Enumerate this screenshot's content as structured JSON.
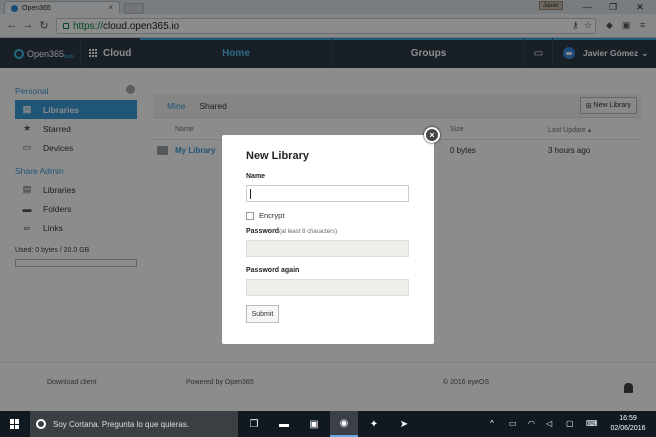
{
  "browser": {
    "tab_title": "Open365",
    "tab_close": "×",
    "profile_user": "Javier",
    "window_controls": [
      "—",
      "❐",
      "✕"
    ],
    "url_scheme": "https://",
    "url_host": "cloud.open365.io",
    "nav_icons": [
      "back-arrow-icon",
      "forward-arrow-icon",
      "reload-icon"
    ]
  },
  "app_header": {
    "logo": "Open365",
    "logo_badge": "beta",
    "cloud_label": "Cloud",
    "nav": [
      "Home",
      "Groups"
    ],
    "user_name": "Javier Gómez",
    "user_caret": "⌄",
    "accent_color": "#3aa7dd"
  },
  "sidebar": {
    "personal_title": "Personal",
    "personal_items": [
      {
        "label": "Libraries",
        "icon": "library-icon",
        "active": true
      },
      {
        "label": "Starred",
        "icon": "star-icon"
      },
      {
        "label": "Devices",
        "icon": "monitor-icon"
      }
    ],
    "share_title": "Share Admin",
    "share_items": [
      {
        "label": "Libraries",
        "icon": "library-icon"
      },
      {
        "label": "Folders",
        "icon": "folder-icon"
      },
      {
        "label": "Links",
        "icon": "link-icon"
      }
    ],
    "usage_text": "Used: 0 bytes / 20.0 GB",
    "usage_fraction": 0
  },
  "main": {
    "tabs": [
      "Mine",
      "Shared"
    ],
    "new_library_button": "New Library",
    "columns": {
      "name": "Name",
      "size": "Size",
      "last_update": "Last Update ▴"
    },
    "rows": [
      {
        "name": "My Library",
        "size": "0 bytes",
        "last_update": "3 hours ago"
      }
    ]
  },
  "footer": {
    "download": "Download client",
    "powered": "Powered by Open365",
    "copyright": "© 2016 eyeOS"
  },
  "modal": {
    "title": "New Library",
    "close_symbol": "×",
    "name_label": "Name",
    "name_value": "",
    "encrypt_label": "Encrypt",
    "encrypt_checked": false,
    "password_label": "Password",
    "password_hint": "(at least 8 characters)",
    "password_again_label": "Password again",
    "submit_label": "Submit"
  },
  "taskbar": {
    "cortana_placeholder": "Soy Cortana. Pregunta lo que quieras.",
    "time": "16:59",
    "date": "02/06/2016"
  }
}
